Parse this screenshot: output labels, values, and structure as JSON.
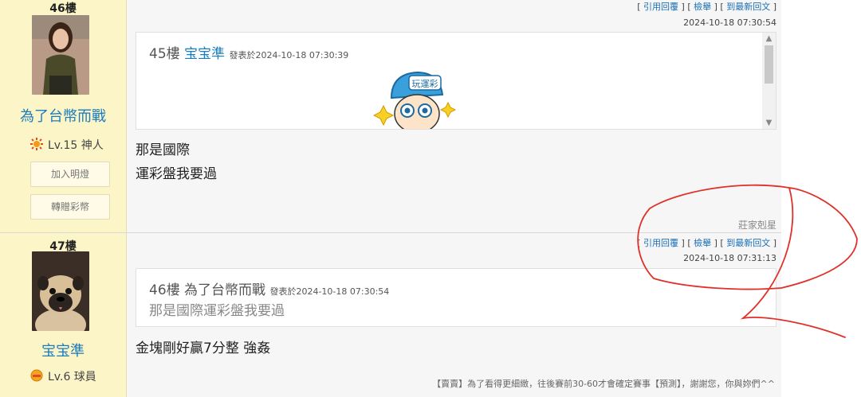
{
  "posts": [
    {
      "floor": "46樓",
      "username": "為了台幣而戰",
      "level": "Lv.15 神人",
      "btn_add": "加入明燈",
      "btn_gift": "轉贈彩幣",
      "links": {
        "quote": "引用回覆",
        "report": "檢舉",
        "latest": "到最新回文"
      },
      "time": "2024-10-18 07:30:54",
      "quote": {
        "floor": "45樓",
        "user": "宝宝準",
        "posted_label": "發表於2024-10-18 07:30:39",
        "sticker_text": "玩運彩"
      },
      "lines": [
        "那是國際",
        "運彩盤我要過"
      ],
      "signature": "莊家剋星"
    },
    {
      "floor": "47樓",
      "username": "宝宝準",
      "level": "Lv.6 球員",
      "links": {
        "quote": "引用回覆",
        "report": "檢舉",
        "latest": "到最新回文"
      },
      "time": "2024-10-18 07:31:13",
      "quote": {
        "floor": "46樓",
        "user": "為了台幣而戰",
        "posted_label": "發表於2024-10-18 07:30:54",
        "text": "那是國際運彩盤我要過"
      },
      "lines": [
        "金塊剛好贏7分整  強姦"
      ],
      "footer": "【賣賣】為了看得更細緻，往後賽前30-60才會確定賽事【預測】，謝謝您，你與妳們^^"
    }
  ],
  "colors": {
    "accent": "#1a7bbd",
    "sidebar": "#fbf5c8",
    "annotation": "#e0302a"
  }
}
